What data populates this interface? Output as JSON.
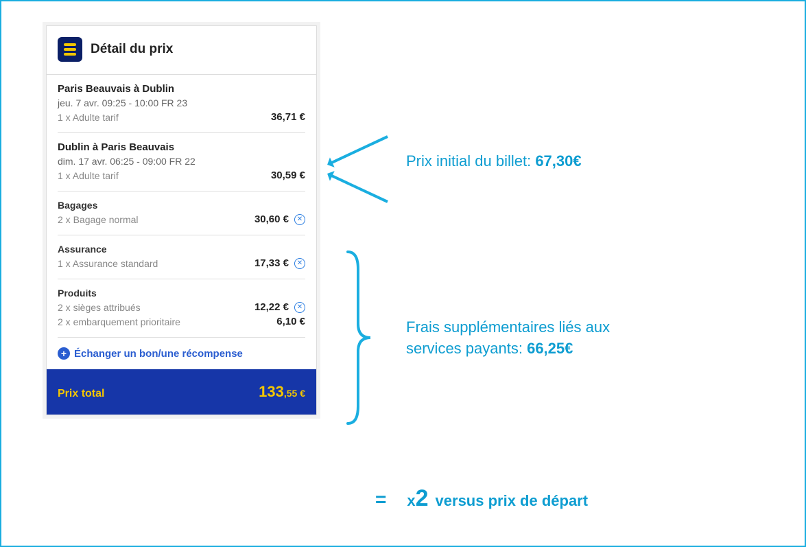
{
  "header": {
    "title": "Détail du prix"
  },
  "segments": [
    {
      "route": "Paris Beauvais à Dublin",
      "datetime": "jeu. 7 avr. 09:25 - 10:00 FR 23",
      "fare_label": "1 x Adulte tarif",
      "price": "36,71 €"
    },
    {
      "route": "Dublin à Paris Beauvais",
      "datetime": "dim. 17 avr. 06:25 - 09:00 FR 22",
      "fare_label": "1 x Adulte tarif",
      "price": "30,59 €"
    }
  ],
  "luggage": {
    "title": "Bagages",
    "line_label": "2 x Bagage normal",
    "price": "30,60 €"
  },
  "insurance": {
    "title": "Assurance",
    "line_label": "1 x  Assurance standard",
    "price": "17,33 €"
  },
  "products": {
    "title": "Produits",
    "line1_label": "2 x sièges attribués",
    "line1_price": "12,22 €",
    "line2_label": "2 x embarquement prioritaire",
    "line2_price": "6,10 €"
  },
  "exchange": {
    "label": "Échanger un bon/une récompense"
  },
  "total": {
    "label": "Prix total",
    "value_int": "133",
    "value_cents": ",55 €"
  },
  "annotations": {
    "initial_price_label": "Prix initial du billet: ",
    "initial_price_value": "67,30€",
    "extra_fees_label1": "Frais supplémentaires liés aux",
    "extra_fees_label2": "services payants: ",
    "extra_fees_value": "66,25€",
    "eq": "=",
    "mult_prefix": "x",
    "mult_value": "2",
    "versus": "versus prix de départ"
  }
}
